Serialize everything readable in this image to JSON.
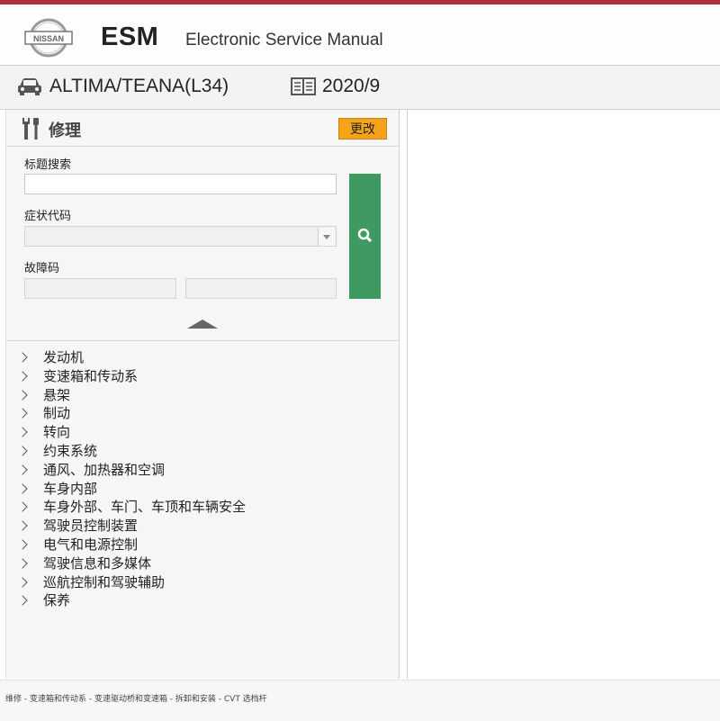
{
  "header": {
    "logo_text": "NISSAN",
    "app_name": "ESM",
    "app_subtitle": "Electronic Service Manual"
  },
  "vehicle": {
    "model": "ALTIMA/TEANA(L34)",
    "version": "2020/9"
  },
  "panel": {
    "title": "修理",
    "change_label": "更改",
    "title_search_label": "标题搜索",
    "title_search_value": "",
    "symptom_code_label": "症状代码",
    "symptom_code_value": "",
    "fault_code_label": "故障码",
    "fault_code_value_1": "",
    "fault_code_value_2": ""
  },
  "tree": {
    "items": [
      {
        "label": "发动机"
      },
      {
        "label": "变速箱和传动系"
      },
      {
        "label": "悬架"
      },
      {
        "label": "制动"
      },
      {
        "label": "转向"
      },
      {
        "label": "约束系统"
      },
      {
        "label": "通风、加热器和空调"
      },
      {
        "label": "车身内部"
      },
      {
        "label": "车身外部、车门、车顶和车辆安全"
      },
      {
        "label": "驾驶员控制装置"
      },
      {
        "label": "电气和电源控制"
      },
      {
        "label": "驾驶信息和多媒体"
      },
      {
        "label": "巡航控制和驾驶辅助"
      },
      {
        "label": "保养"
      }
    ]
  },
  "status": {
    "breadcrumb": "维修 - 变速箱和传动系 - 变速驱动桥和变速箱 - 拆卸和安装 - CVT 选档杆"
  },
  "colors": {
    "accent_orange": "#f5a31a",
    "search_green": "#3e9a61",
    "top_line": "#b03040"
  },
  "icons": [
    "nissan-logo",
    "car-icon",
    "book-icon",
    "wrench-icon",
    "search-icon",
    "collapse-up-icon",
    "chevron-right-icon"
  ]
}
